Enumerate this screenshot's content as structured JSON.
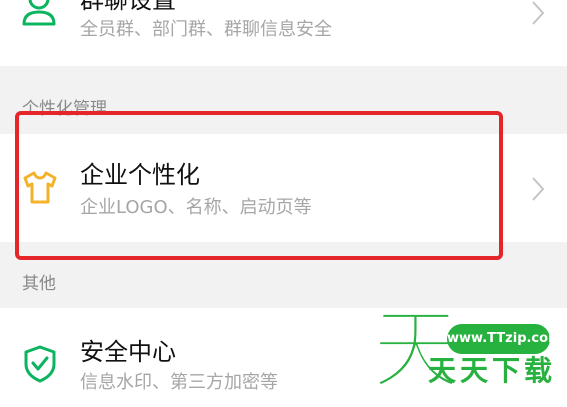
{
  "rows": {
    "group_settings": {
      "title": "群聊设置",
      "subtitle": "全员群、部门群、群聊信息安全",
      "icon": "group-person-icon"
    },
    "customization": {
      "title": "企业个性化",
      "subtitle": "企业LOGO、名称、启动页等",
      "icon": "tshirt-icon"
    },
    "security_center": {
      "title": "安全中心",
      "subtitle": "信息水印、第三方加密等",
      "icon": "shield-check-icon"
    }
  },
  "sections": {
    "personalization": "个性化管理",
    "other": "其他"
  },
  "watermark": {
    "big_char": "天",
    "url": "www.TTzip.com",
    "text": "天天下载"
  },
  "colors": {
    "green_icon": "#0bb45f",
    "yellow_icon": "#f2b32b",
    "highlight": "#e4262b",
    "watermark_green": "#27b13f"
  }
}
